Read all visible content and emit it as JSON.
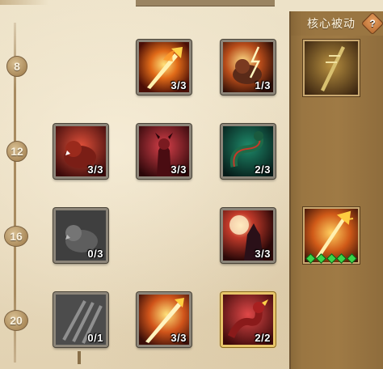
{
  "panel": {
    "title": "核心被动",
    "help_icon": "question-icon",
    "help_label": "?"
  },
  "levels": [
    "8",
    "12",
    "16",
    "20"
  ],
  "tiles": {
    "r0c1": {
      "count": "3/3",
      "icon": "fire-spear-icon"
    },
    "r0c2": {
      "count": "1/3",
      "icon": "lightning-beast-icon"
    },
    "r1c0": {
      "count": "3/3",
      "icon": "red-beast-icon"
    },
    "r1c1": {
      "count": "3/3",
      "icon": "demon-warrior-icon"
    },
    "r1c2": {
      "count": "2/3",
      "icon": "serpent-dragon-icon"
    },
    "r2c0": {
      "count": "0/3",
      "icon": "stone-beast-icon"
    },
    "r2c2": {
      "count": "3/3",
      "icon": "howling-wolf-icon"
    },
    "r3c0": {
      "count": "0/1",
      "icon": "claw-slash-icon"
    },
    "r3c1": {
      "count": "3/3",
      "icon": "flame-spear-icon"
    },
    "r3c2": {
      "count": "2/2",
      "icon": "fire-dragon-icon"
    }
  },
  "core": [
    {
      "icon": "golden-spear-icon"
    },
    {
      "icon": "flame-trident-icon",
      "pips": 5
    }
  ],
  "colors": {
    "parchment": "#e9dcc0",
    "panel": "#9f7a45",
    "pip": "#39d44a",
    "gold_border": "#e8c66a"
  }
}
